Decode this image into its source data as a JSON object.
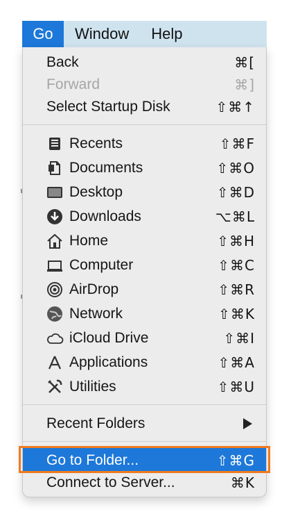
{
  "menubar": {
    "items": [
      {
        "label": "Go",
        "active": true
      },
      {
        "label": "Window",
        "active": false
      },
      {
        "label": "Help",
        "active": false
      }
    ]
  },
  "menu": {
    "section1": [
      {
        "label": "Back",
        "shortcut": "⌘[",
        "enabled": true
      },
      {
        "label": "Forward",
        "shortcut": "⌘]",
        "enabled": false
      },
      {
        "label": "Select Startup Disk",
        "shortcut": "⇧⌘↑",
        "enabled": true
      }
    ],
    "section2": [
      {
        "label": "Recents",
        "shortcut": "⇧⌘F",
        "icon": "recents-icon"
      },
      {
        "label": "Documents",
        "shortcut": "⇧⌘O",
        "icon": "documents-icon"
      },
      {
        "label": "Desktop",
        "shortcut": "⇧⌘D",
        "icon": "desktop-icon"
      },
      {
        "label": "Downloads",
        "shortcut": "⌥⌘L",
        "icon": "downloads-icon"
      },
      {
        "label": "Home",
        "shortcut": "⇧⌘H",
        "icon": "home-icon"
      },
      {
        "label": "Computer",
        "shortcut": "⇧⌘C",
        "icon": "computer-icon"
      },
      {
        "label": "AirDrop",
        "shortcut": "⇧⌘R",
        "icon": "airdrop-icon"
      },
      {
        "label": "Network",
        "shortcut": "⇧⌘K",
        "icon": "network-icon"
      },
      {
        "label": "iCloud Drive",
        "shortcut": "⇧⌘I",
        "icon": "icloud-icon"
      },
      {
        "label": "Applications",
        "shortcut": "⇧⌘A",
        "icon": "applications-icon"
      },
      {
        "label": "Utilities",
        "shortcut": "⇧⌘U",
        "icon": "utilities-icon"
      }
    ],
    "section3": [
      {
        "label": "Recent Folders",
        "submenu_icon": "submenu-arrow-icon"
      }
    ],
    "section4": [
      {
        "label": "Go to Folder...",
        "shortcut": "⇧⌘G",
        "highlighted": true
      },
      {
        "label": "Connect to Server...",
        "shortcut": "⌘K",
        "highlighted": false
      }
    ]
  },
  "colors": {
    "accent": "#1d78d9",
    "callout": "#f07a1e",
    "menu_bg": "#ececec",
    "menubar_bg": "#cfe3ef",
    "disabled_text": "#a6a6a6"
  }
}
